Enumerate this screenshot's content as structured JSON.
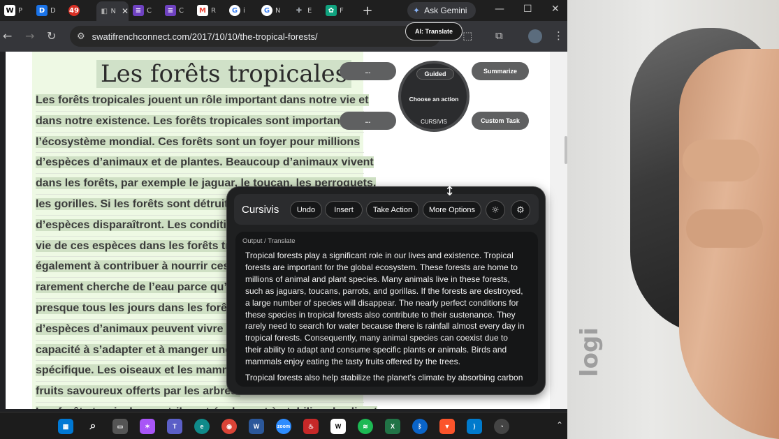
{
  "browser": {
    "tabs": [
      {
        "initial": "W",
        "label": "P",
        "color": "#ffffff"
      },
      {
        "initial": "D",
        "label": "D",
        "color": "#1a73e8"
      },
      {
        "initial": "49",
        "label": "",
        "color": "#d93025"
      },
      {
        "initial": "",
        "label": "N",
        "color": "#35363a",
        "active": true
      },
      {
        "initial": "",
        "label": "C",
        "color": "#6f42c1"
      },
      {
        "initial": "",
        "label": "C",
        "color": "#6f42c1"
      },
      {
        "initial": "M",
        "label": "R",
        "color": "#ea4335"
      },
      {
        "initial": "G",
        "label": "i",
        "color": "#ffffff"
      },
      {
        "initial": "G",
        "label": "N",
        "color": "#ffffff"
      },
      {
        "initial": "",
        "label": "E",
        "color": "#9aa0a6"
      },
      {
        "initial": "",
        "label": "F",
        "color": "#10a37f"
      }
    ],
    "ask_gemini": "Ask Gemini",
    "url": "swatifrenchconnect.com/2017/10/10/the-tropical-forests/",
    "ai_translate": "AI: Translate"
  },
  "article": {
    "title": "Les forêts tropicales",
    "lines": [
      "Les forêts tropicales jouent un rôle important dans notre vie et",
      "dans notre existence. Les forêts tropicales sont importantes pour",
      "l’écosystème mondial. Ces forêts sont un foyer pour millions",
      "d’espèces d’animaux et de plantes. Beaucoup d’animaux vivent",
      "dans les forêts, par exemple le jaguar, le toucan, les perroquets,",
      "les gorilles. Si les forêts sont détruites, u",
      "d’espèces disparaîtront. Les conditions p",
      "vie de ces espèces dans les forêts tropica",
      "également à contribuer à nourrir ces esp",
      "rarement cherche de l’eau parce qu’il y a",
      "presque tous les jours dans les forêts tro",
      "d’espèces d’animaux peuvent vivre ense",
      "capacité à s’adapter et à manger une pla",
      "spécifique. Les oiseaux et les mammifère",
      "fruits savoureux offerts par les arbres.",
      "Les forêts tropicales contribuent également à stabiliser le climat"
    ]
  },
  "radial": {
    "left_top": "...",
    "left_bottom": "...",
    "guided": "Guided",
    "center": "Choose an action",
    "bottom": "CURSIVIS",
    "summarize": "Summarize",
    "custom_task": "Custom Task"
  },
  "panel": {
    "title": "Cursivis",
    "undo": "Undo",
    "insert": "Insert",
    "take_action": "Take Action",
    "more_options": "More Options",
    "crumb_output": "Output",
    "crumb_sep": "/",
    "crumb_translate": "Translate",
    "output": "Tropical forests play a significant role in our lives and existence. Tropical forests are important for the global ecosystem. These forests are home to millions of animal and plant species. Many animals live in these forests, such as jaguars, toucans, parrots, and gorillas. If the forests are destroyed, a large number of species will disappear. The nearly perfect conditions for these species in tropical forests also contribute to their sustenance. They rarely need to search for water because there is rainfall almost every day in tropical forests. Consequently, many animal species can coexist due to their ability to adapt and consume specific plants or animals. Birds and mammals enjoy eating the tasty fruits offered by the trees.",
    "output_next": "Tropical forests also help stabilize the planet's climate by absorbing carbon"
  },
  "taskbar": {
    "zoom_label": "zoom",
    "word_label": "W",
    "excel_label": "X",
    "wiki_label": "W"
  },
  "photo": {
    "brand": "logi"
  }
}
